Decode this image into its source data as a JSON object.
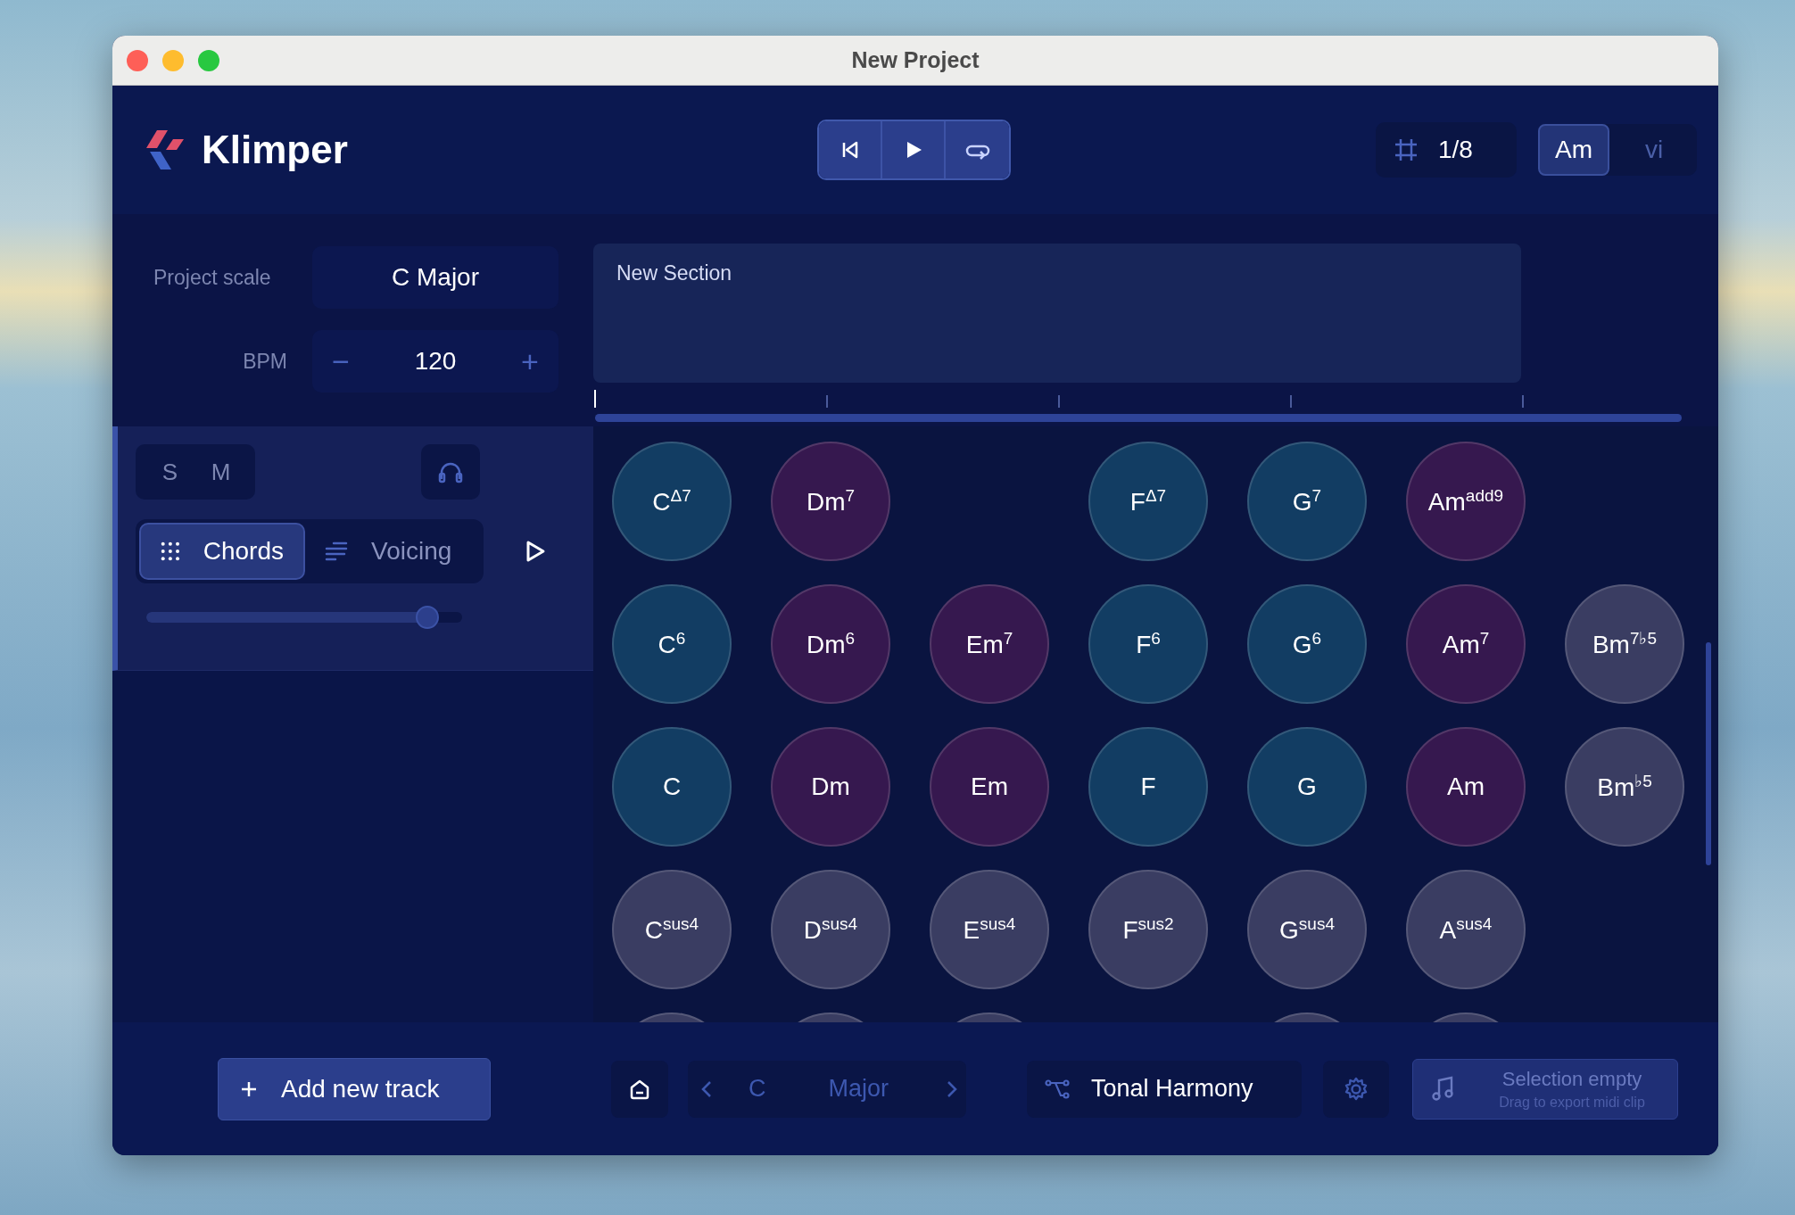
{
  "window": {
    "title": "New Project"
  },
  "app": {
    "name": "Klimper"
  },
  "transport": [
    {
      "kind": "previous"
    },
    {
      "kind": "play"
    },
    {
      "kind": "loop"
    }
  ],
  "quantize": {
    "value": "1/8"
  },
  "chord_display": [
    {
      "label": "Am",
      "selected": true
    },
    {
      "label": "vi",
      "selected": false
    }
  ],
  "project": {
    "scale_label": "Project scale",
    "scale": "C Major",
    "bpm_label": "BPM",
    "bpm": "120",
    "decrement": "−",
    "increment": "+"
  },
  "section": {
    "title": "New Section"
  },
  "track": {
    "solo": "S",
    "mute": "M",
    "modes": [
      {
        "label": "Chords",
        "kind": "grid",
        "selected": true
      },
      {
        "label": "Voicing",
        "kind": "lines",
        "selected": false
      }
    ],
    "volume": {
      "level": 0.89
    }
  },
  "chord_rows": [
    [
      {
        "label": "C$^{Δ7}$",
        "color": "#123d63"
      },
      {
        "label": "Dm$^{7}$",
        "color": "#36184f"
      },
      null,
      {
        "label": "F$^{Δ7}$",
        "color": "#123d63"
      },
      {
        "label": "G$^{7}$",
        "color": "#123d63"
      },
      {
        "label": "Am$^{add9}$",
        "color": "#36184f"
      },
      null
    ],
    [
      {
        "label": "C$^{6}$",
        "color": "#123d63"
      },
      {
        "label": "Dm$^{6}$",
        "color": "#36184f"
      },
      {
        "label": "Em$^{7}$",
        "color": "#36184f"
      },
      {
        "label": "F$^{6}$",
        "color": "#123d63"
      },
      {
        "label": "G$^{6}$",
        "color": "#123d63"
      },
      {
        "label": "Am$^{7}$",
        "color": "#36184f"
      },
      {
        "label": "Bm$^{7♭5}$",
        "color": "#3a3d62"
      }
    ],
    [
      {
        "label": "C",
        "color": "#123d63"
      },
      {
        "label": "Dm",
        "color": "#36184f"
      },
      {
        "label": "Em",
        "color": "#36184f"
      },
      {
        "label": "F",
        "color": "#123d63"
      },
      {
        "label": "G",
        "color": "#123d63"
      },
      {
        "label": "Am",
        "color": "#36184f"
      },
      {
        "label": "Bm$^{♭5}$",
        "color": "#3a3d62"
      }
    ],
    [
      {
        "label": "C$^{sus4}$",
        "color": "#3a3d62"
      },
      {
        "label": "D$^{sus4}$",
        "color": "#3a3d62"
      },
      {
        "label": "E$^{sus4}$",
        "color": "#3a3d62"
      },
      {
        "label": "F$^{sus2}$",
        "color": "#3a3d62"
      },
      {
        "label": "G$^{sus4}$",
        "color": "#3a3d62"
      },
      {
        "label": "A$^{sus4}$",
        "color": "#3a3d62"
      },
      null
    ],
    [
      {
        "color": "#3a3d62"
      },
      {
        "color": "#3a3d62"
      },
      {
        "color": "#3a3d62"
      },
      null,
      {
        "color": "#3a3d62"
      },
      {
        "color": "#3a3d62"
      },
      null
    ]
  ],
  "bottom": {
    "add_track": "Add new track",
    "key": {
      "root": "C",
      "mode": "Major"
    },
    "harmony": "Tonal Harmony",
    "export": {
      "title": "Selection empty",
      "hint": "Drag to export midi clip",
      "disabled": true
    }
  }
}
